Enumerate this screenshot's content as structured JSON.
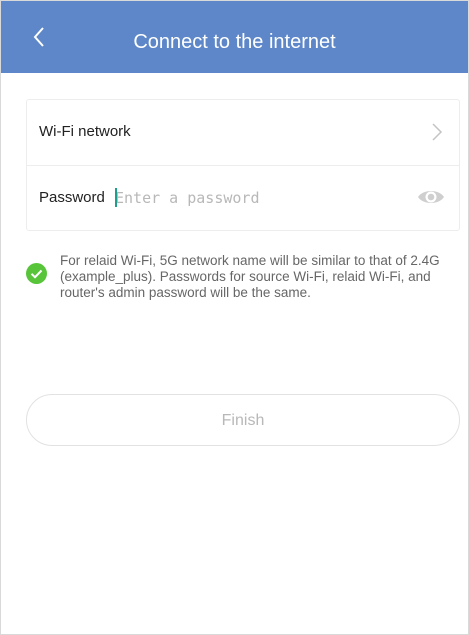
{
  "header": {
    "title": "Connect to the internet",
    "back_icon": "chevron-left-icon",
    "background_color": "#5d87c9"
  },
  "form": {
    "wifi_label": "Wi-Fi network",
    "wifi_chevron_icon": "chevron-right-icon",
    "password_label": "Password",
    "password_value": "",
    "password_placeholder": "Enter a password",
    "password_visibility_icon": "eye-icon"
  },
  "note": {
    "check_icon": "checkmark-circle-icon",
    "check_color": "#58c43a",
    "text": "For relaid Wi-Fi, 5G network name will be similar to that of 2.4G (example_plus). Passwords for source Wi-Fi, relaid Wi-Fi, and router's admin password will be the same."
  },
  "actions": {
    "finish_label": "Finish"
  }
}
